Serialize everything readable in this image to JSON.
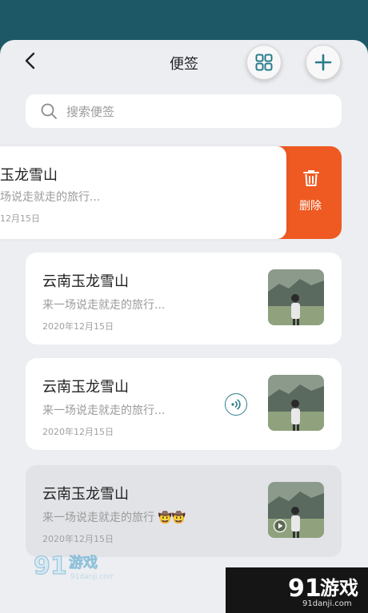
{
  "header": {
    "title": "便签"
  },
  "search": {
    "placeholder": "搜索便签"
  },
  "swiped_note": {
    "title": "玉龙雪山",
    "snippet": "场说走就走的旅行...",
    "date": "12月15日"
  },
  "delete_action": {
    "label": "删除",
    "color": "#ee5a22"
  },
  "notes": [
    {
      "title": "云南玉龙雪山",
      "snippet": "来一场说走就走的旅行...",
      "date": "2020年12月15日"
    },
    {
      "title": "云南玉龙雪山",
      "snippet": "来一场说走就走的旅行...",
      "date": "2020年12月15日"
    },
    {
      "title": "云南玉龙雪山",
      "snippet": "来一场说走就走的旅行",
      "emoji": "🤠🤠",
      "date": "2020年12月15日"
    }
  ],
  "watermark": {
    "left_brand": "游戏",
    "left_num": "91",
    "left_url": "91danji.com",
    "right_brand": "游戏",
    "right_num": "91",
    "right_url": "91danji.com"
  },
  "colors": {
    "status_bar": "#1d5866",
    "accent": "#2a7c8a",
    "background": "#eceef2"
  }
}
